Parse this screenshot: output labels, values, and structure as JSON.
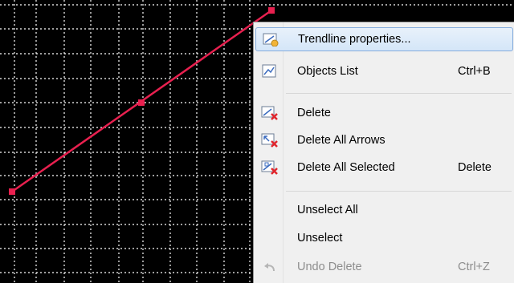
{
  "chart": {
    "background": "#000000",
    "grid_color": "#ffffff",
    "trendline_color": "#e8204f"
  },
  "menu": {
    "items": [
      {
        "label": "Trendline properties...",
        "shortcut": "",
        "icon": "trendline-properties-icon",
        "highlighted": true,
        "enabled": true
      },
      {
        "label": "Objects List",
        "shortcut": "Ctrl+B",
        "icon": "objects-list-icon",
        "enabled": true
      },
      {
        "label": "Delete",
        "shortcut": "",
        "icon": "delete-icon",
        "enabled": true
      },
      {
        "label": "Delete All Arrows",
        "shortcut": "",
        "icon": "delete-all-arrows-icon",
        "enabled": true
      },
      {
        "label": "Delete All Selected",
        "shortcut": "Delete",
        "icon": "delete-all-selected-icon",
        "enabled": true
      },
      {
        "label": "Unselect All",
        "shortcut": "",
        "enabled": true
      },
      {
        "label": "Unselect",
        "shortcut": "",
        "enabled": true
      },
      {
        "label": "Undo Delete",
        "shortcut": "Ctrl+Z",
        "icon": "undo-icon",
        "enabled": false
      }
    ]
  }
}
